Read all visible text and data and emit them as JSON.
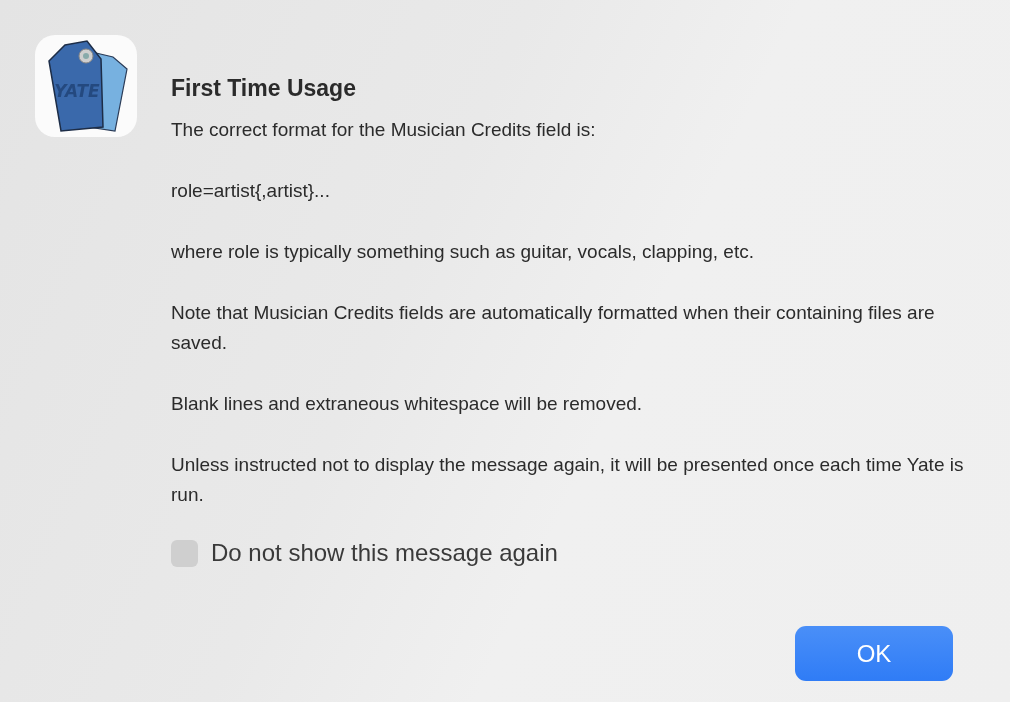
{
  "app_icon": {
    "label": "YATE"
  },
  "title": "First Time Usage",
  "paragraphs": [
    "The correct format for the Musician Credits field is:",
    "role=artist{,artist}...",
    "where role is typically something such as guitar, vocals, clapping, etc.",
    "Note that Musician Credits fields are automatically formatted when their containing files are saved.",
    "Blank lines and extraneous whitespace will be removed.",
    "Unless instructed not to display the message again, it will be presented once each time Yate is run."
  ],
  "checkbox": {
    "label": "Do not show this message again",
    "checked": false
  },
  "buttons": [
    {
      "label": "OK",
      "kind": "default"
    }
  ]
}
